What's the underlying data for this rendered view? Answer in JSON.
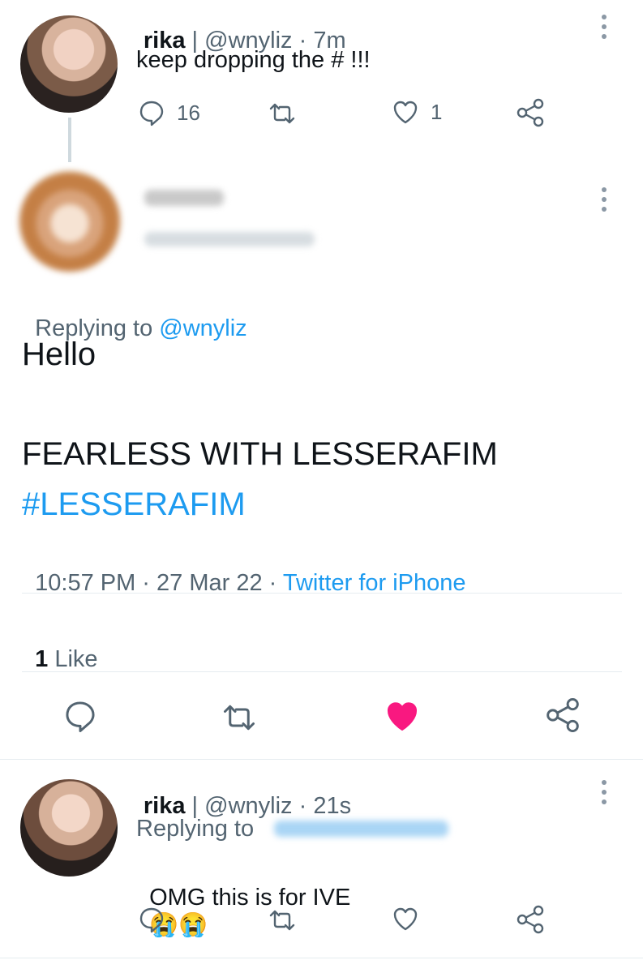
{
  "tweet1": {
    "name": "rika",
    "separator": " | ",
    "handle": "@wnyliz",
    "time": " · 7m",
    "text": "keep dropping the # !!!",
    "reply_count": "16",
    "like_count": "1"
  },
  "main_tweet": {
    "replying_prefix": "Replying to ",
    "replying_handle": "@wnyliz",
    "text_line1": "Hello",
    "text_line2": "FEARLESS WITH LESSERAFIM",
    "hashtag": "#LESSERAFIM",
    "timestamp": "10:57 PM · 27 Mar 22",
    "source_sep": " · ",
    "source": "Twitter for iPhone",
    "likes_count": "1",
    "likes_label": " Like"
  },
  "reply_tweet": {
    "name": "rika",
    "separator": " | ",
    "handle": "@wnyliz",
    "time": " · 21s",
    "replying_prefix": "Replying to ",
    "text": "OMG this is for IVE",
    "emojis": "😭😭"
  },
  "colors": {
    "accent": "#1d9bf0",
    "like": "#f91880",
    "muted": "#536471",
    "divider": "#e6ecf0"
  }
}
